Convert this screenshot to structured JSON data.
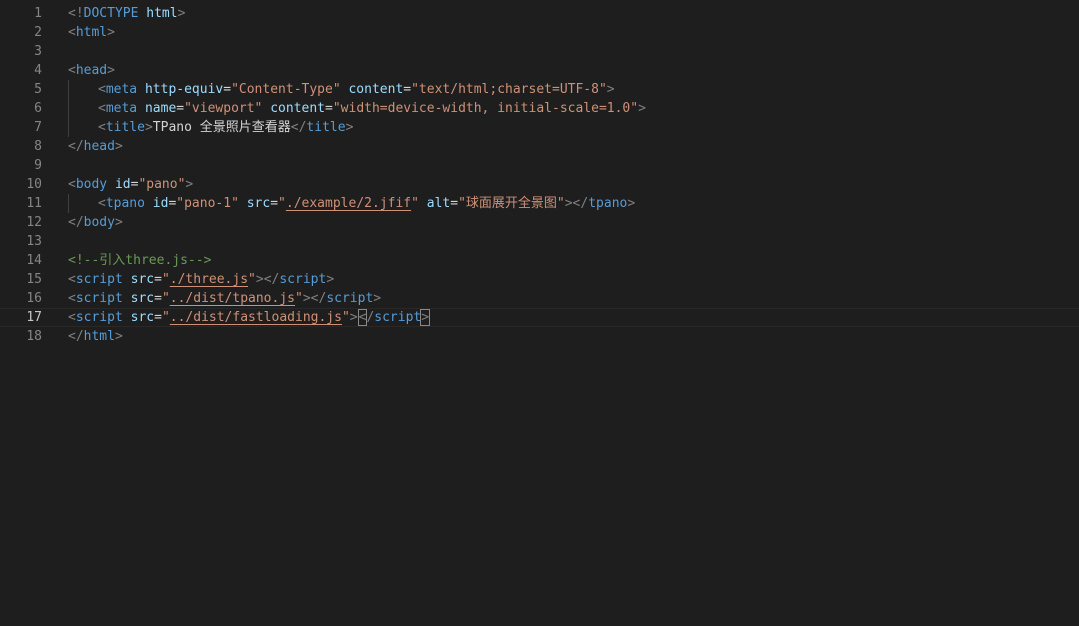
{
  "lines": [
    {
      "n": "1",
      "tokens": [
        [
          "p",
          "<!"
        ],
        [
          "d",
          "DOCTYPE"
        ],
        [
          "x",
          " "
        ],
        [
          "a",
          "html"
        ],
        [
          "p",
          ">"
        ]
      ]
    },
    {
      "n": "2",
      "tokens": [
        [
          "p",
          "<"
        ],
        [
          "t",
          "html"
        ],
        [
          "p",
          ">"
        ]
      ]
    },
    {
      "n": "3",
      "tokens": []
    },
    {
      "n": "4",
      "tokens": [
        [
          "p",
          "<"
        ],
        [
          "t",
          "head"
        ],
        [
          "p",
          ">"
        ]
      ]
    },
    {
      "n": "5",
      "indent": true,
      "tokens": [
        [
          "p",
          "<"
        ],
        [
          "t",
          "meta"
        ],
        [
          "x",
          " "
        ],
        [
          "a",
          "http-equiv"
        ],
        [
          "x",
          "="
        ],
        [
          "s",
          "\"Content-Type\""
        ],
        [
          "x",
          " "
        ],
        [
          "a",
          "content"
        ],
        [
          "x",
          "="
        ],
        [
          "s",
          "\"text/html;charset=UTF-8\""
        ],
        [
          "p",
          ">"
        ]
      ]
    },
    {
      "n": "6",
      "indent": true,
      "tokens": [
        [
          "p",
          "<"
        ],
        [
          "t",
          "meta"
        ],
        [
          "x",
          " "
        ],
        [
          "a",
          "name"
        ],
        [
          "x",
          "="
        ],
        [
          "s",
          "\"viewport\""
        ],
        [
          "x",
          " "
        ],
        [
          "a",
          "content"
        ],
        [
          "x",
          "="
        ],
        [
          "s",
          "\"width=device-width, initial-scale=1.0\""
        ],
        [
          "p",
          ">"
        ]
      ]
    },
    {
      "n": "7",
      "indent": true,
      "tokens": [
        [
          "p",
          "<"
        ],
        [
          "t",
          "title"
        ],
        [
          "p",
          ">"
        ],
        [
          "x",
          "TPano 全景照片查看器"
        ],
        [
          "p",
          "</"
        ],
        [
          "t",
          "title"
        ],
        [
          "p",
          ">"
        ]
      ]
    },
    {
      "n": "8",
      "tokens": [
        [
          "p",
          "</"
        ],
        [
          "t",
          "head"
        ],
        [
          "p",
          ">"
        ]
      ]
    },
    {
      "n": "9",
      "tokens": []
    },
    {
      "n": "10",
      "tokens": [
        [
          "p",
          "<"
        ],
        [
          "t",
          "body"
        ],
        [
          "x",
          " "
        ],
        [
          "a",
          "id"
        ],
        [
          "x",
          "="
        ],
        [
          "s",
          "\"pano\""
        ],
        [
          "p",
          ">"
        ]
      ]
    },
    {
      "n": "11",
      "indent": true,
      "tokens": [
        [
          "p",
          "<"
        ],
        [
          "t",
          "tpano"
        ],
        [
          "x",
          " "
        ],
        [
          "a",
          "id"
        ],
        [
          "x",
          "="
        ],
        [
          "s",
          "\"pano-1\""
        ],
        [
          "x",
          " "
        ],
        [
          "a",
          "src"
        ],
        [
          "x",
          "="
        ],
        [
          "s",
          "\""
        ],
        [
          "sl",
          "./example/2.jfif"
        ],
        [
          "s",
          "\""
        ],
        [
          "x",
          " "
        ],
        [
          "a",
          "alt"
        ],
        [
          "x",
          "="
        ],
        [
          "s",
          "\"球面展开全景图\""
        ],
        [
          "p",
          "></"
        ],
        [
          "t",
          "tpano"
        ],
        [
          "p",
          ">"
        ]
      ]
    },
    {
      "n": "12",
      "tokens": [
        [
          "p",
          "</"
        ],
        [
          "t",
          "body"
        ],
        [
          "p",
          ">"
        ]
      ]
    },
    {
      "n": "13",
      "tokens": []
    },
    {
      "n": "14",
      "tokens": [
        [
          "c",
          "<!--引入three.js-->"
        ]
      ]
    },
    {
      "n": "15",
      "tokens": [
        [
          "p",
          "<"
        ],
        [
          "t",
          "script"
        ],
        [
          "x",
          " "
        ],
        [
          "a",
          "src"
        ],
        [
          "x",
          "="
        ],
        [
          "s",
          "\""
        ],
        [
          "sl",
          "./three.js"
        ],
        [
          "s",
          "\""
        ],
        [
          "p",
          "></"
        ],
        [
          "t",
          "script"
        ],
        [
          "p",
          ">"
        ]
      ]
    },
    {
      "n": "16",
      "tokens": [
        [
          "p",
          "<"
        ],
        [
          "t",
          "script"
        ],
        [
          "x",
          " "
        ],
        [
          "a",
          "src"
        ],
        [
          "x",
          "="
        ],
        [
          "s",
          "\""
        ],
        [
          "sl",
          "../dist/tpano.js"
        ],
        [
          "s",
          "\""
        ],
        [
          "p",
          "></"
        ],
        [
          "t",
          "script"
        ],
        [
          "p",
          ">"
        ]
      ]
    },
    {
      "n": "17",
      "current": true,
      "tokens": [
        [
          "p",
          "<"
        ],
        [
          "t",
          "script"
        ],
        [
          "x",
          " "
        ],
        [
          "a",
          "src"
        ],
        [
          "x",
          "="
        ],
        [
          "s",
          "\""
        ],
        [
          "sl",
          "../dist/fastloading.js"
        ],
        [
          "s",
          "\""
        ],
        [
          "p",
          ">"
        ],
        [
          "cursor",
          ""
        ],
        [
          "pm",
          "<"
        ],
        [
          "p",
          "/"
        ],
        [
          "t",
          "script"
        ],
        [
          "pm",
          ">"
        ]
      ]
    },
    {
      "n": "18",
      "tokens": [
        [
          "p",
          "</"
        ],
        [
          "t",
          "html"
        ],
        [
          "p",
          ">"
        ]
      ]
    }
  ]
}
